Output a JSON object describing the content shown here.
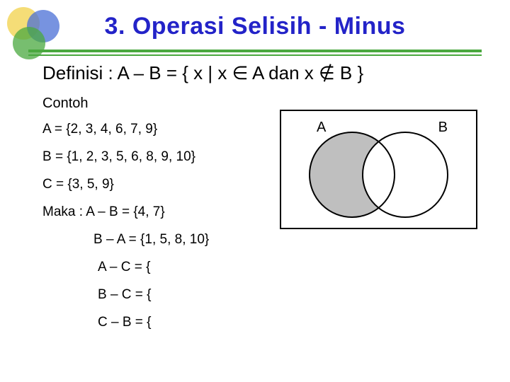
{
  "title": "3. Operasi  Selisih - Minus",
  "definition": "Definisi :  A – B  =  { x | x ∈ A   dan   x  ∉ B }",
  "contoh_label": "Contoh",
  "lines": {
    "setA": "A = {2, 3, 4, 6, 7, 9}",
    "setB": "B = {1, 2, 3, 5, 6, 8, 9, 10}",
    "setC": "C = {3, 5, 9}",
    "maka": "Maka :   A – B = {4, 7}",
    "bma": "B – A = {1, 5, 8, 10}",
    "amc": "A – C = {",
    "bmc": "B – C = {",
    "cmb": "C – B = {"
  },
  "venn": {
    "labelA": "A",
    "labelB": "B"
  }
}
